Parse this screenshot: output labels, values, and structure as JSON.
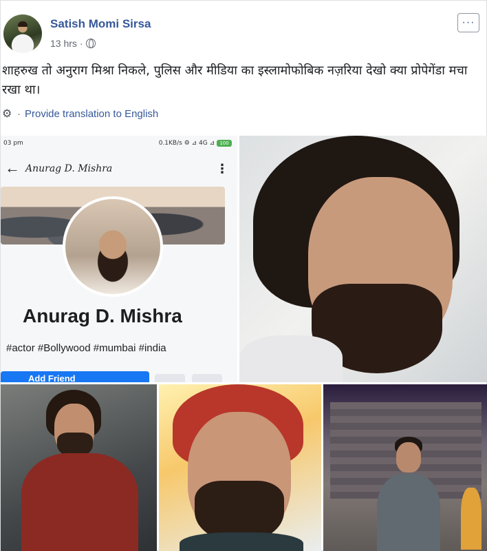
{
  "post": {
    "author": "Satish Momi Sirsa",
    "time": "13 hrs",
    "separator": "·",
    "more_label": "···",
    "text": "शाहरुख तो अनुराग मिश्रा निकले, पुलिस और मीडिया का इस्लामोफोबिक नज़रिया देखो क्या प्रोपेगेंडा मचा रखा था।",
    "translate_separator": "·",
    "translate_label": "Provide translation to English"
  },
  "phone_screenshot": {
    "status_time": "03 pm",
    "status_right": "0.1KB/s ⚙ ⊿ 4G ⊿",
    "battery": "100",
    "handle": "Anurag D. Mishra",
    "name": "Anurag D. Mishra",
    "tags": "#actor #Bollywood #mumbai #india",
    "add_friend_label": "Add Friend"
  },
  "icons": {
    "globe": "globe-icon",
    "gear": "gear-icon",
    "more": "more-icon",
    "back": "back-arrow-icon",
    "kebab": "kebab-menu-icon"
  },
  "colors": {
    "link": "#365899",
    "meta": "#616770",
    "fb_blue": "#1877f2"
  }
}
